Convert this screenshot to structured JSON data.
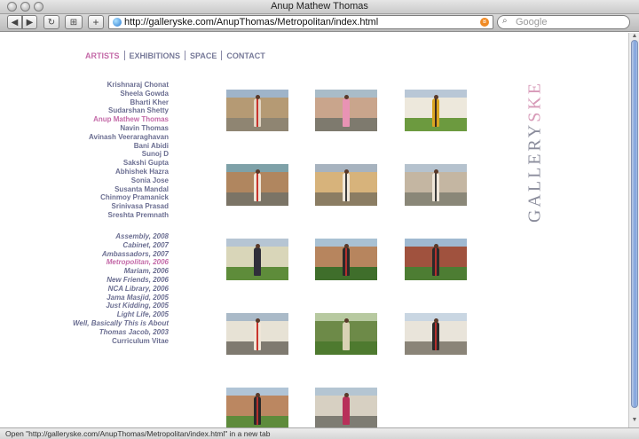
{
  "window": {
    "title": "Anup Mathew Thomas"
  },
  "toolbar": {
    "back_label": "◀",
    "forward_label": "▶",
    "reload_label": "↻",
    "bookmark_label": "⊞",
    "add_label": "+",
    "url": "http://galleryske.com/AnupThomas/Metropolitan/index.html",
    "search_placeholder": "Google"
  },
  "nav": {
    "items": [
      {
        "label": "ARTISTS",
        "active": true
      },
      {
        "label": "EXHIBITIONS",
        "active": false
      },
      {
        "label": "SPACE",
        "active": false
      },
      {
        "label": "CONTACT",
        "active": false
      }
    ]
  },
  "artists": [
    "Krishnaraj Chonat",
    "Sheela Gowda",
    "Bharti Kher",
    "Sudarshan Shetty",
    "Anup Mathew Thomas",
    "Navin Thomas",
    "Avinash Veeraraghavan",
    "Bani Abidi",
    "Sunoj D",
    "Sakshi Gupta",
    "Abhishek Hazra",
    "Sonia Jose",
    "Susanta Mandal",
    "Chinmoy Pramanick",
    "Srinivasa Prasad",
    "Sreshta Premnath"
  ],
  "artists_active_index": 4,
  "exhibitions": [
    "Assembly, 2008",
    "Cabinet, 2007",
    "Ambassadors, 2007",
    "Metropolitan, 2006",
    "Mariam, 2006",
    "New Friends, 2006",
    "NCA Library, 2006",
    "Jama Masjid, 2005",
    "Just Kidding, 2005",
    "Light Life, 2005",
    "Well, Basically This is About Thomas Jacob, 2003"
  ],
  "exhibitions_active_index": 3,
  "curriculum_label": "Curriculum Vitae",
  "brand": {
    "part1": "GALLERY",
    "part2": "SKE"
  },
  "thumbnails": [
    {
      "sky": "#9fb4c9",
      "bld": "#b59a74",
      "gnd": "#8f8572",
      "fig": "#e2d6c4",
      "accent": "#c9352d"
    },
    {
      "sky": "#a9bcc8",
      "bld": "#c9a58c",
      "gnd": "#7e7a6e",
      "fig": "#e893b4",
      "accent": "#e893b4"
    },
    {
      "sky": "#b9c7d6",
      "bld": "#ede8dc",
      "gnd": "#6c9a3f",
      "fig": "#d9a521",
      "accent": "#3d2a1e"
    },
    {
      "sky": "#7ea1a8",
      "bld": "#b0865f",
      "gnd": "#7b7466",
      "fig": "#efe6d8",
      "accent": "#c9352d"
    },
    {
      "sky": "#a7b3bf",
      "bld": "#d7b37b",
      "gnd": "#8b7d63",
      "fig": "#efe6d8",
      "accent": "#3b3b3b"
    },
    {
      "sky": "#b5c2ce",
      "bld": "#c4b6a2",
      "gnd": "#8a8778",
      "fig": "#efe6d8",
      "accent": "#3b3b3b"
    },
    {
      "sky": "#b6c5d3",
      "bld": "#d9d6b9",
      "gnd": "#5e8c3a",
      "fig": "#2f2f3a",
      "accent": "#2f2f3a"
    },
    {
      "sky": "#a9c1d3",
      "bld": "#b7855e",
      "gnd": "#3f6e2b",
      "fig": "#2a2a2a",
      "accent": "#b5302d"
    },
    {
      "sky": "#9fb9d1",
      "bld": "#a0523e",
      "gnd": "#4d7d33",
      "fig": "#2a2a2a",
      "accent": "#b5302d"
    },
    {
      "sky": "#aabac8",
      "bld": "#e7e2d5",
      "gnd": "#7f7a70",
      "fig": "#efe6d8",
      "accent": "#c9352d"
    },
    {
      "sky": "#b7c9a0",
      "bld": "#6d8a48",
      "gnd": "#4e7a2f",
      "fig": "#d9d2b4",
      "accent": "#d9d2b4"
    },
    {
      "sky": "#c9d6e2",
      "bld": "#e9e4da",
      "gnd": "#8a8478",
      "fig": "#2a2a2a",
      "accent": "#b5302d"
    },
    {
      "sky": "#b0c4d6",
      "bld": "#bb8761",
      "gnd": "#5e8b3b",
      "fig": "#2a2a2a",
      "accent": "#b5302d"
    },
    {
      "sky": "#b4c5d2",
      "bld": "#d7d0c2",
      "gnd": "#7e7c73",
      "fig": "#b8305a",
      "accent": "#b8305a"
    }
  ],
  "status": "Open \"http://galleryske.com/AnupThomas/Metropolitan/index.html\" in a new tab",
  "colors": {
    "link": "#6c6f92",
    "active": "#c46aa8",
    "brand_grey": "#8b8d9c",
    "brand_pink": "#d79ab8"
  }
}
